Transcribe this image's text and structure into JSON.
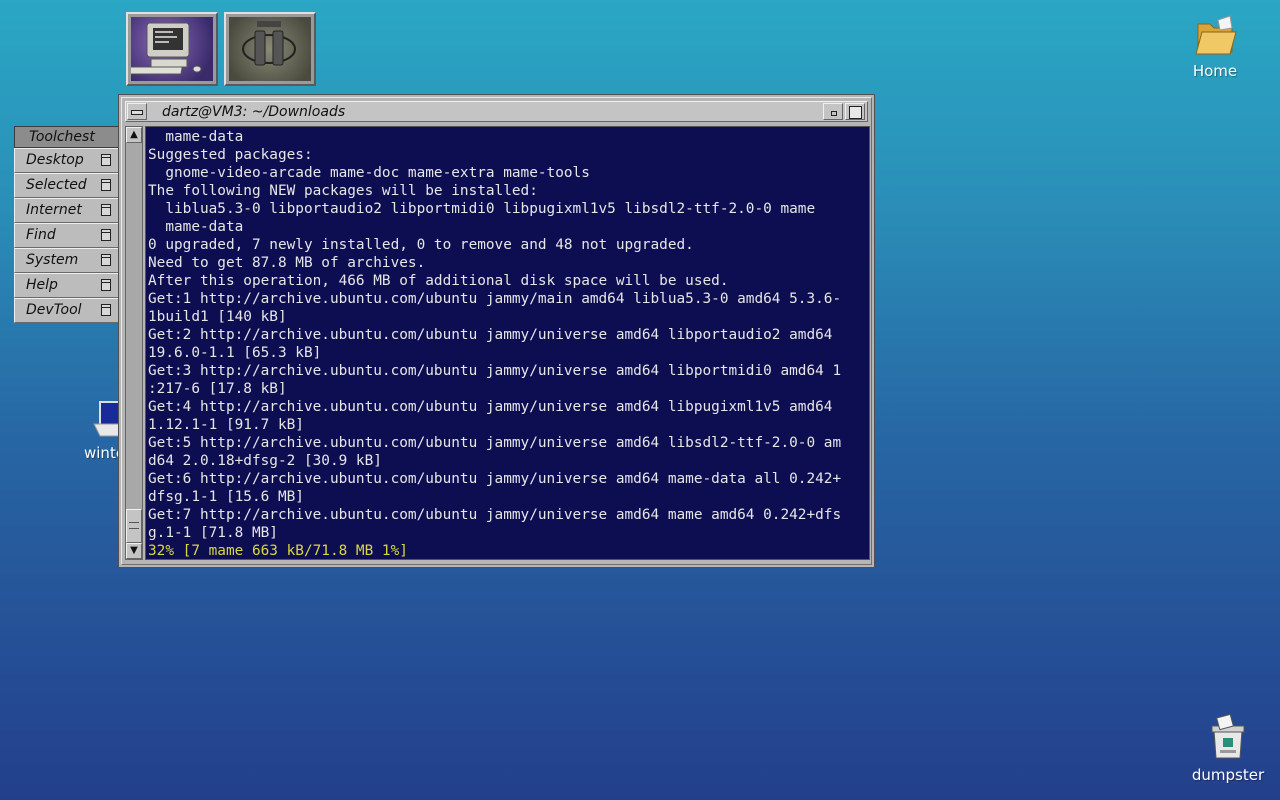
{
  "dock": {
    "tiles": [
      {
        "icon": "computer-monitor-icon"
      },
      {
        "icon": "dd-logo-icon"
      }
    ]
  },
  "toolchest": {
    "title": "Toolchest",
    "items": [
      {
        "label": "Desktop"
      },
      {
        "label": "Selected"
      },
      {
        "label": "Internet"
      },
      {
        "label": "Find"
      },
      {
        "label": "System"
      },
      {
        "label": "Help"
      },
      {
        "label": "DevTool"
      }
    ]
  },
  "terminal": {
    "title": "dartz@VM3: ~/Downloads",
    "lines": [
      "  mame-data",
      "Suggested packages:",
      "  gnome-video-arcade mame-doc mame-extra mame-tools",
      "The following NEW packages will be installed:",
      "  liblua5.3-0 libportaudio2 libportmidi0 libpugixml1v5 libsdl2-ttf-2.0-0 mame",
      "  mame-data",
      "0 upgraded, 7 newly installed, 0 to remove and 48 not upgraded.",
      "Need to get 87.8 MB of archives.",
      "After this operation, 466 MB of additional disk space will be used.",
      "Get:1 http://archive.ubuntu.com/ubuntu jammy/main amd64 liblua5.3-0 amd64 5.3.6-",
      "1build1 [140 kB]",
      "Get:2 http://archive.ubuntu.com/ubuntu jammy/universe amd64 libportaudio2 amd64",
      "19.6.0-1.1 [65.3 kB]",
      "Get:3 http://archive.ubuntu.com/ubuntu jammy/universe amd64 libportmidi0 amd64 1",
      ":217-6 [17.8 kB]",
      "Get:4 http://archive.ubuntu.com/ubuntu jammy/universe amd64 libpugixml1v5 amd64",
      "1.12.1-1 [91.7 kB]",
      "Get:5 http://archive.ubuntu.com/ubuntu jammy/universe amd64 libsdl2-ttf-2.0-0 am",
      "d64 2.0.18+dfsg-2 [30.9 kB]",
      "Get:6 http://archive.ubuntu.com/ubuntu jammy/universe amd64 mame-data all 0.242+",
      "dfsg.1-1 [15.6 MB]",
      "Get:7 http://archive.ubuntu.com/ubuntu jammy/universe amd64 mame amd64 0.242+dfs",
      "g.1-1 [71.8 MB]"
    ],
    "progress_line": "32% [7 mame 663 kB/71.8 MB 1%]",
    "scroll_up": "▲",
    "scroll_down": "▼"
  },
  "desktop_icons": {
    "home": {
      "label": "Home",
      "icon": "folder-icon"
    },
    "dumpster": {
      "label": "dumpster",
      "icon": "dumpster-icon"
    },
    "winterm": {
      "label": "winte",
      "icon": "terminal-icon"
    }
  },
  "colors": {
    "terminal_bg": "#0d0d52",
    "terminal_fg": "#e6e6e6",
    "progress_fg": "#d8d840",
    "window_chrome": "#b5b5b5"
  }
}
